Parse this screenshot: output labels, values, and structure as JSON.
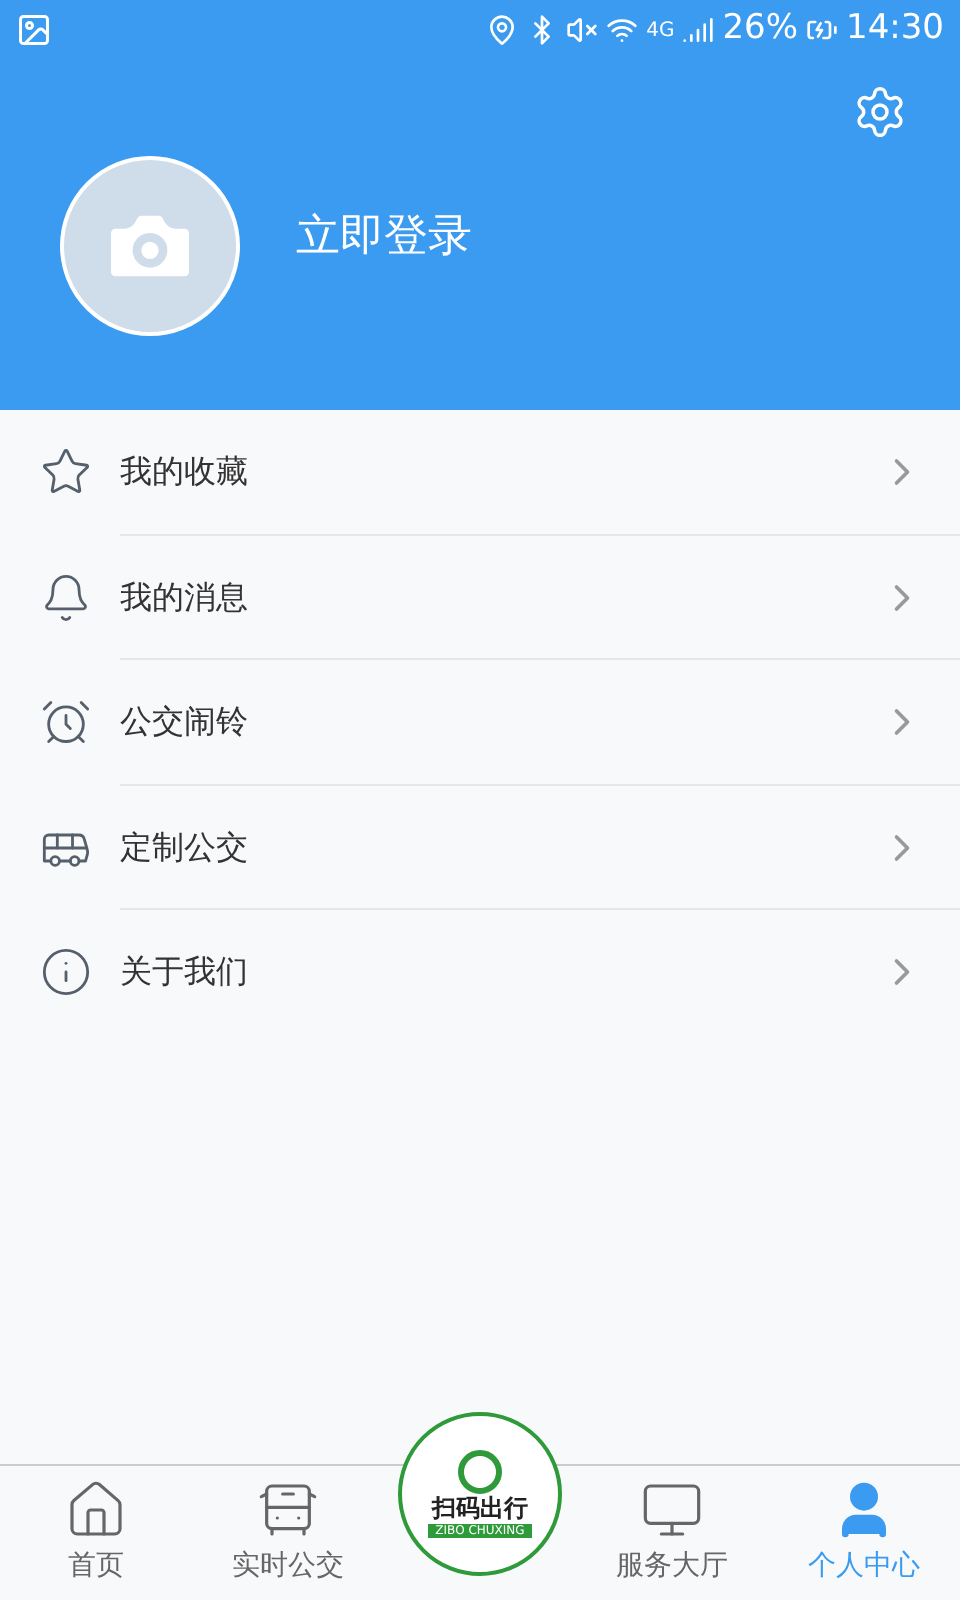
{
  "status_bar": {
    "battery": "26%",
    "time": "14:30",
    "network": "4G"
  },
  "header": {
    "login_label": "立即登录"
  },
  "menu": [
    {
      "kind": "star",
      "label": "我的收藏"
    },
    {
      "kind": "bell",
      "label": "我的消息"
    },
    {
      "kind": "alarm",
      "label": "公交闹铃"
    },
    {
      "kind": "bus",
      "label": "定制公交"
    },
    {
      "kind": "info",
      "label": "关于我们"
    }
  ],
  "tab_bar": {
    "tabs": [
      {
        "kind": "home",
        "label": "首页",
        "selected": false
      },
      {
        "kind": "bus",
        "label": "实时公交",
        "selected": false
      },
      {
        "kind": "scan",
        "label": "扫码出行",
        "sublabel": "ZIBO CHUXING",
        "selected": false
      },
      {
        "kind": "monitor",
        "label": "服务大厅",
        "selected": false
      },
      {
        "kind": "person",
        "label": "个人中心",
        "selected": true
      }
    ]
  }
}
